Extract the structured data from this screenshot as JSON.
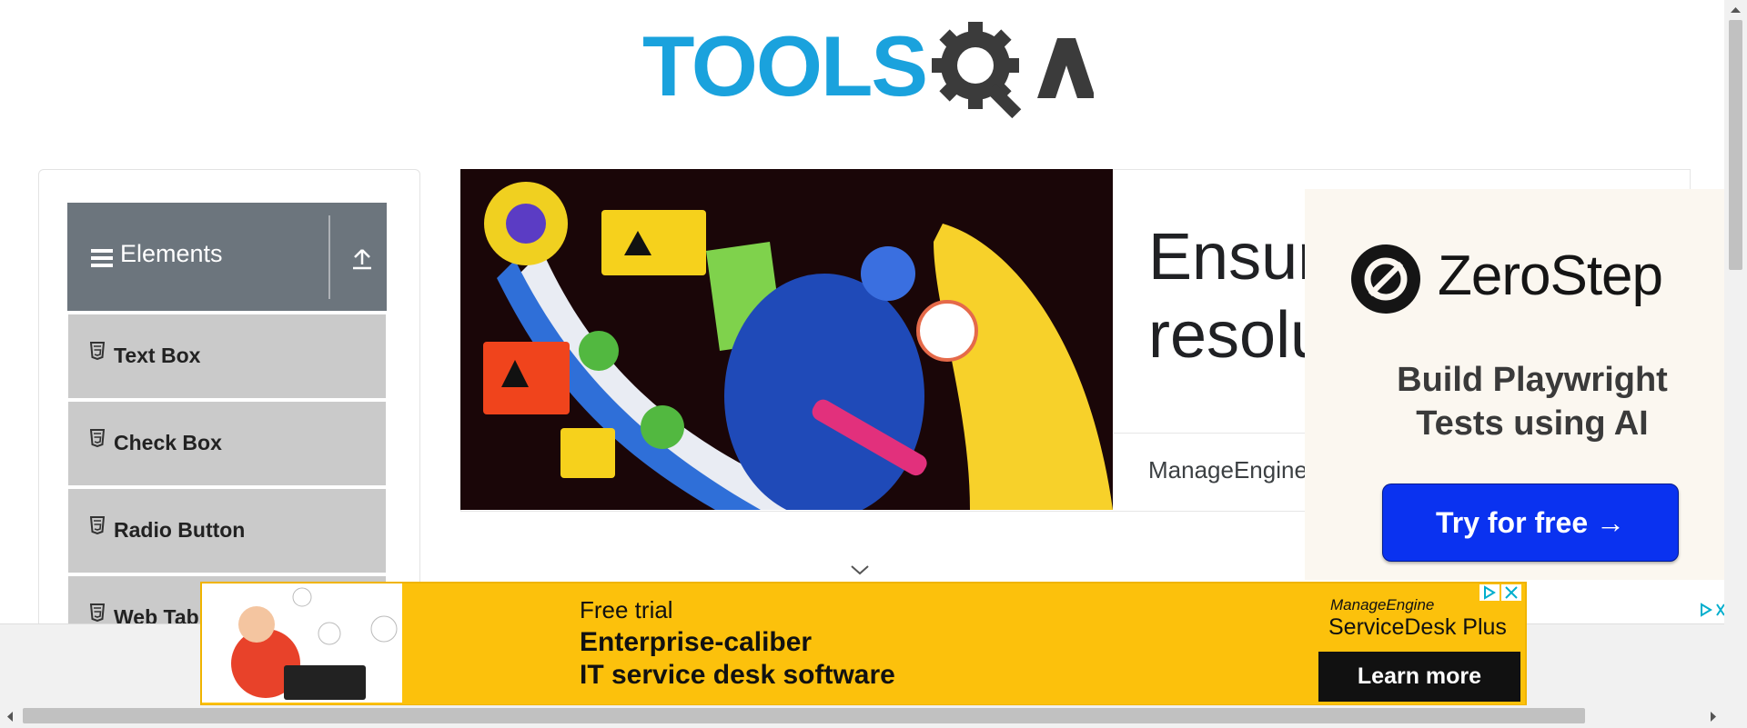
{
  "header": {
    "logo_text": "TOOLS",
    "logo_suffix": "QA"
  },
  "sidebar": {
    "group_title": "Elements",
    "items": [
      {
        "label": "Text Box"
      },
      {
        "label": "Check Box"
      },
      {
        "label": "Radio Button"
      },
      {
        "label": "Web Tab"
      }
    ]
  },
  "banner_ad": {
    "headline_line1": "Ensur",
    "headline_line2": "resolu",
    "advertiser": "ManageEngine"
  },
  "right_ad": {
    "brand": "ZeroStep",
    "tagline": "Build Playwright Tests using AI",
    "cta": "Try for free →"
  },
  "bottom_ad": {
    "pretitle": "Free trial",
    "title_line1": "Enterprise-caliber",
    "title_line2": "IT service desk software",
    "brand": "ManageEngine",
    "product": "ServiceDesk Plus",
    "cta": "Learn more"
  },
  "colors": {
    "brand_blue": "#1aa2dd",
    "sidebar_header": "#6c757d",
    "menu_item_bg": "#cacaca",
    "cta_blue": "#0a32f0",
    "ad_yellow": "#fcc10c"
  }
}
